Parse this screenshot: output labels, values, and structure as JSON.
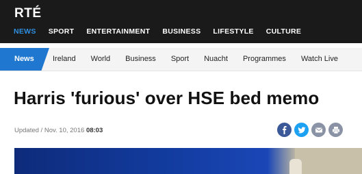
{
  "brand": {
    "logo": "RTÉ"
  },
  "main_nav": [
    {
      "label": "NEWS",
      "active": true
    },
    {
      "label": "SPORT"
    },
    {
      "label": "ENTERTAINMENT"
    },
    {
      "label": "BUSINESS"
    },
    {
      "label": "LIFESTYLE"
    },
    {
      "label": "CULTURE"
    }
  ],
  "sub_nav": {
    "active": "News",
    "items": [
      "Ireland",
      "World",
      "Business",
      "Sport",
      "Nuacht",
      "Programmes",
      "Watch Live"
    ]
  },
  "article": {
    "headline": "Harris 'furious' over HSE bed memo",
    "updated_prefix": "Updated / Nov. 10, 2016",
    "updated_time": "08:03"
  },
  "share": [
    {
      "icon": "facebook-icon",
      "color": "#3b5998"
    },
    {
      "icon": "twitter-icon",
      "color": "#1da1f2"
    },
    {
      "icon": "email-icon",
      "color": "#8a93a6"
    },
    {
      "icon": "print-icon",
      "color": "#8a93a6"
    }
  ],
  "colors": {
    "accent": "#1f77d0",
    "nav_bg": "#1a1a1a",
    "active_nav": "#2f8fe0"
  }
}
